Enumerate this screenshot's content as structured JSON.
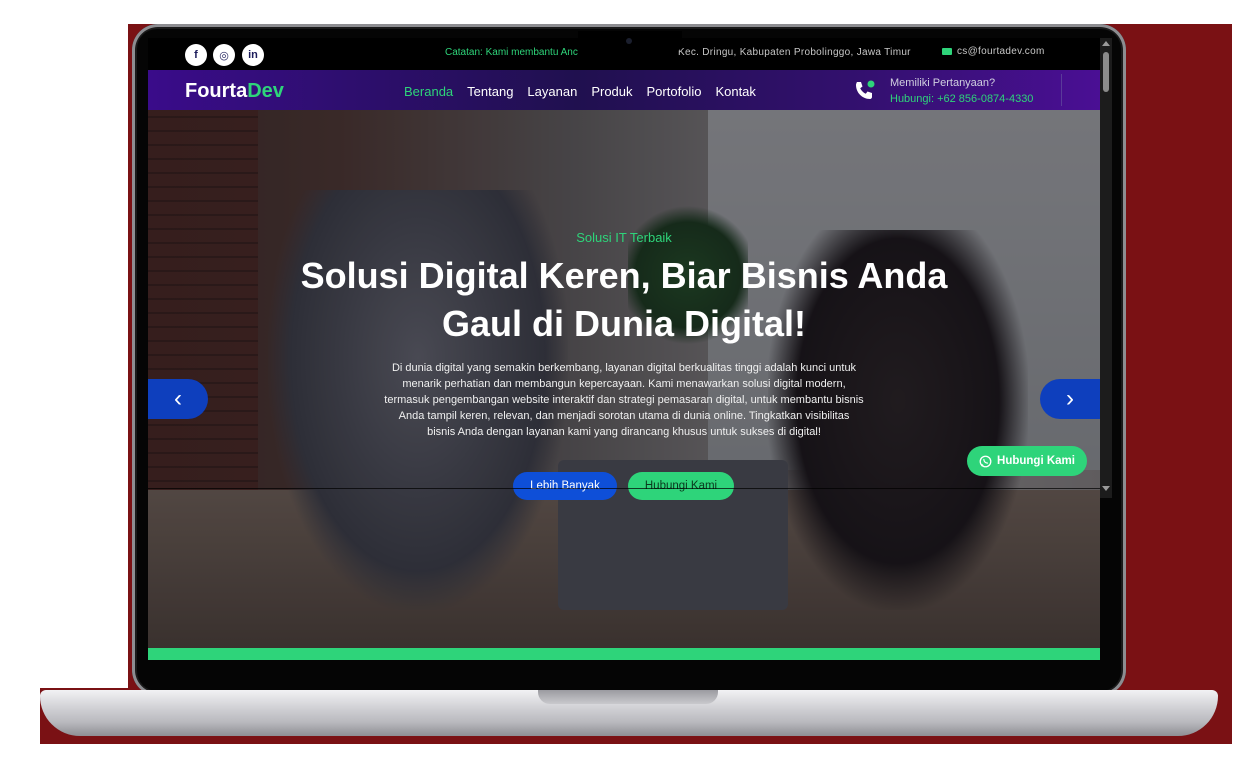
{
  "topbar": {
    "socials": [
      {
        "icon": "facebook-icon",
        "glyph": "f"
      },
      {
        "icon": "instagram-icon",
        "glyph": "◎"
      },
      {
        "icon": "linkedin-icon",
        "glyph": "in"
      }
    ],
    "notice": "Catatan: Kami membantu Anc",
    "address": "Kec. Dringu, Kabupaten Probolinggo, Jawa Timur",
    "email": "cs@fourtadev.com"
  },
  "navbar": {
    "logo_part1": "Fourta",
    "logo_part2": "Dev",
    "menu": [
      {
        "label": "Beranda",
        "active": true
      },
      {
        "label": "Tentang"
      },
      {
        "label": "Layanan"
      },
      {
        "label": "Produk"
      },
      {
        "label": "Portofolio"
      },
      {
        "label": "Kontak"
      }
    ],
    "question": "Memiliki Pertanyaan?",
    "phone": "Hubungi: +62 856-0874-4330"
  },
  "hero": {
    "eyebrow": "Solusi IT Terbaik",
    "headline": "Solusi Digital Keren, Biar Bisnis Anda Gaul di Dunia Digital!",
    "description": "Di dunia digital yang semakin berkembang, layanan digital berkualitas tinggi adalah kunci untuk menarik perhatian dan membangun kepercayaan. Kami menawarkan solusi digital modern, termasuk pengembangan website interaktif dan strategi pemasaran digital, untuk membantu bisnis Anda tampil keren, relevan, dan menjadi sorotan utama di dunia online. Tingkatkan visibilitas bisnis Anda dengan layanan kami yang dirancang khusus untuk sukses di digital!",
    "btn_primary": "Lebih Banyak",
    "btn_secondary": "Hubungi Kami",
    "prev_arrow": "‹",
    "next_arrow": "›"
  },
  "whatsapp": {
    "label": "Hubungi Kami",
    "icon": "whatsapp-icon"
  },
  "colors": {
    "accent": "#2ed47a",
    "primary": "#0e4fd8",
    "nav": "#3a0c8a",
    "backdrop": "#7a1114"
  }
}
